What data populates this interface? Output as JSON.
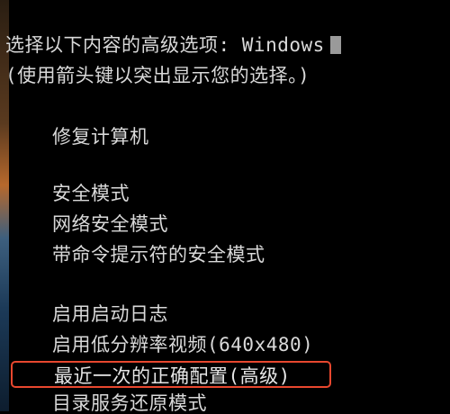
{
  "header": {
    "line1": "选择以下内容的高级选项: Windows",
    "line2": "(使用箭头键以突出显示您的选择。)"
  },
  "menu": {
    "repair": "修复计算机",
    "safe_mode": "安全模式",
    "safe_mode_network": "网络安全模式",
    "safe_mode_cmd": "带命令提示符的安全模式",
    "boot_logging": "启用启动日志",
    "low_resolution": "启用低分辨率视频(640x480)",
    "last_known_good": "最近一次的正确配置(高级)",
    "directory_services": "目录服务还原模式"
  },
  "colors": {
    "background": "#000000",
    "text": "#d9d9d9",
    "highlight_border": "#e8472e"
  }
}
